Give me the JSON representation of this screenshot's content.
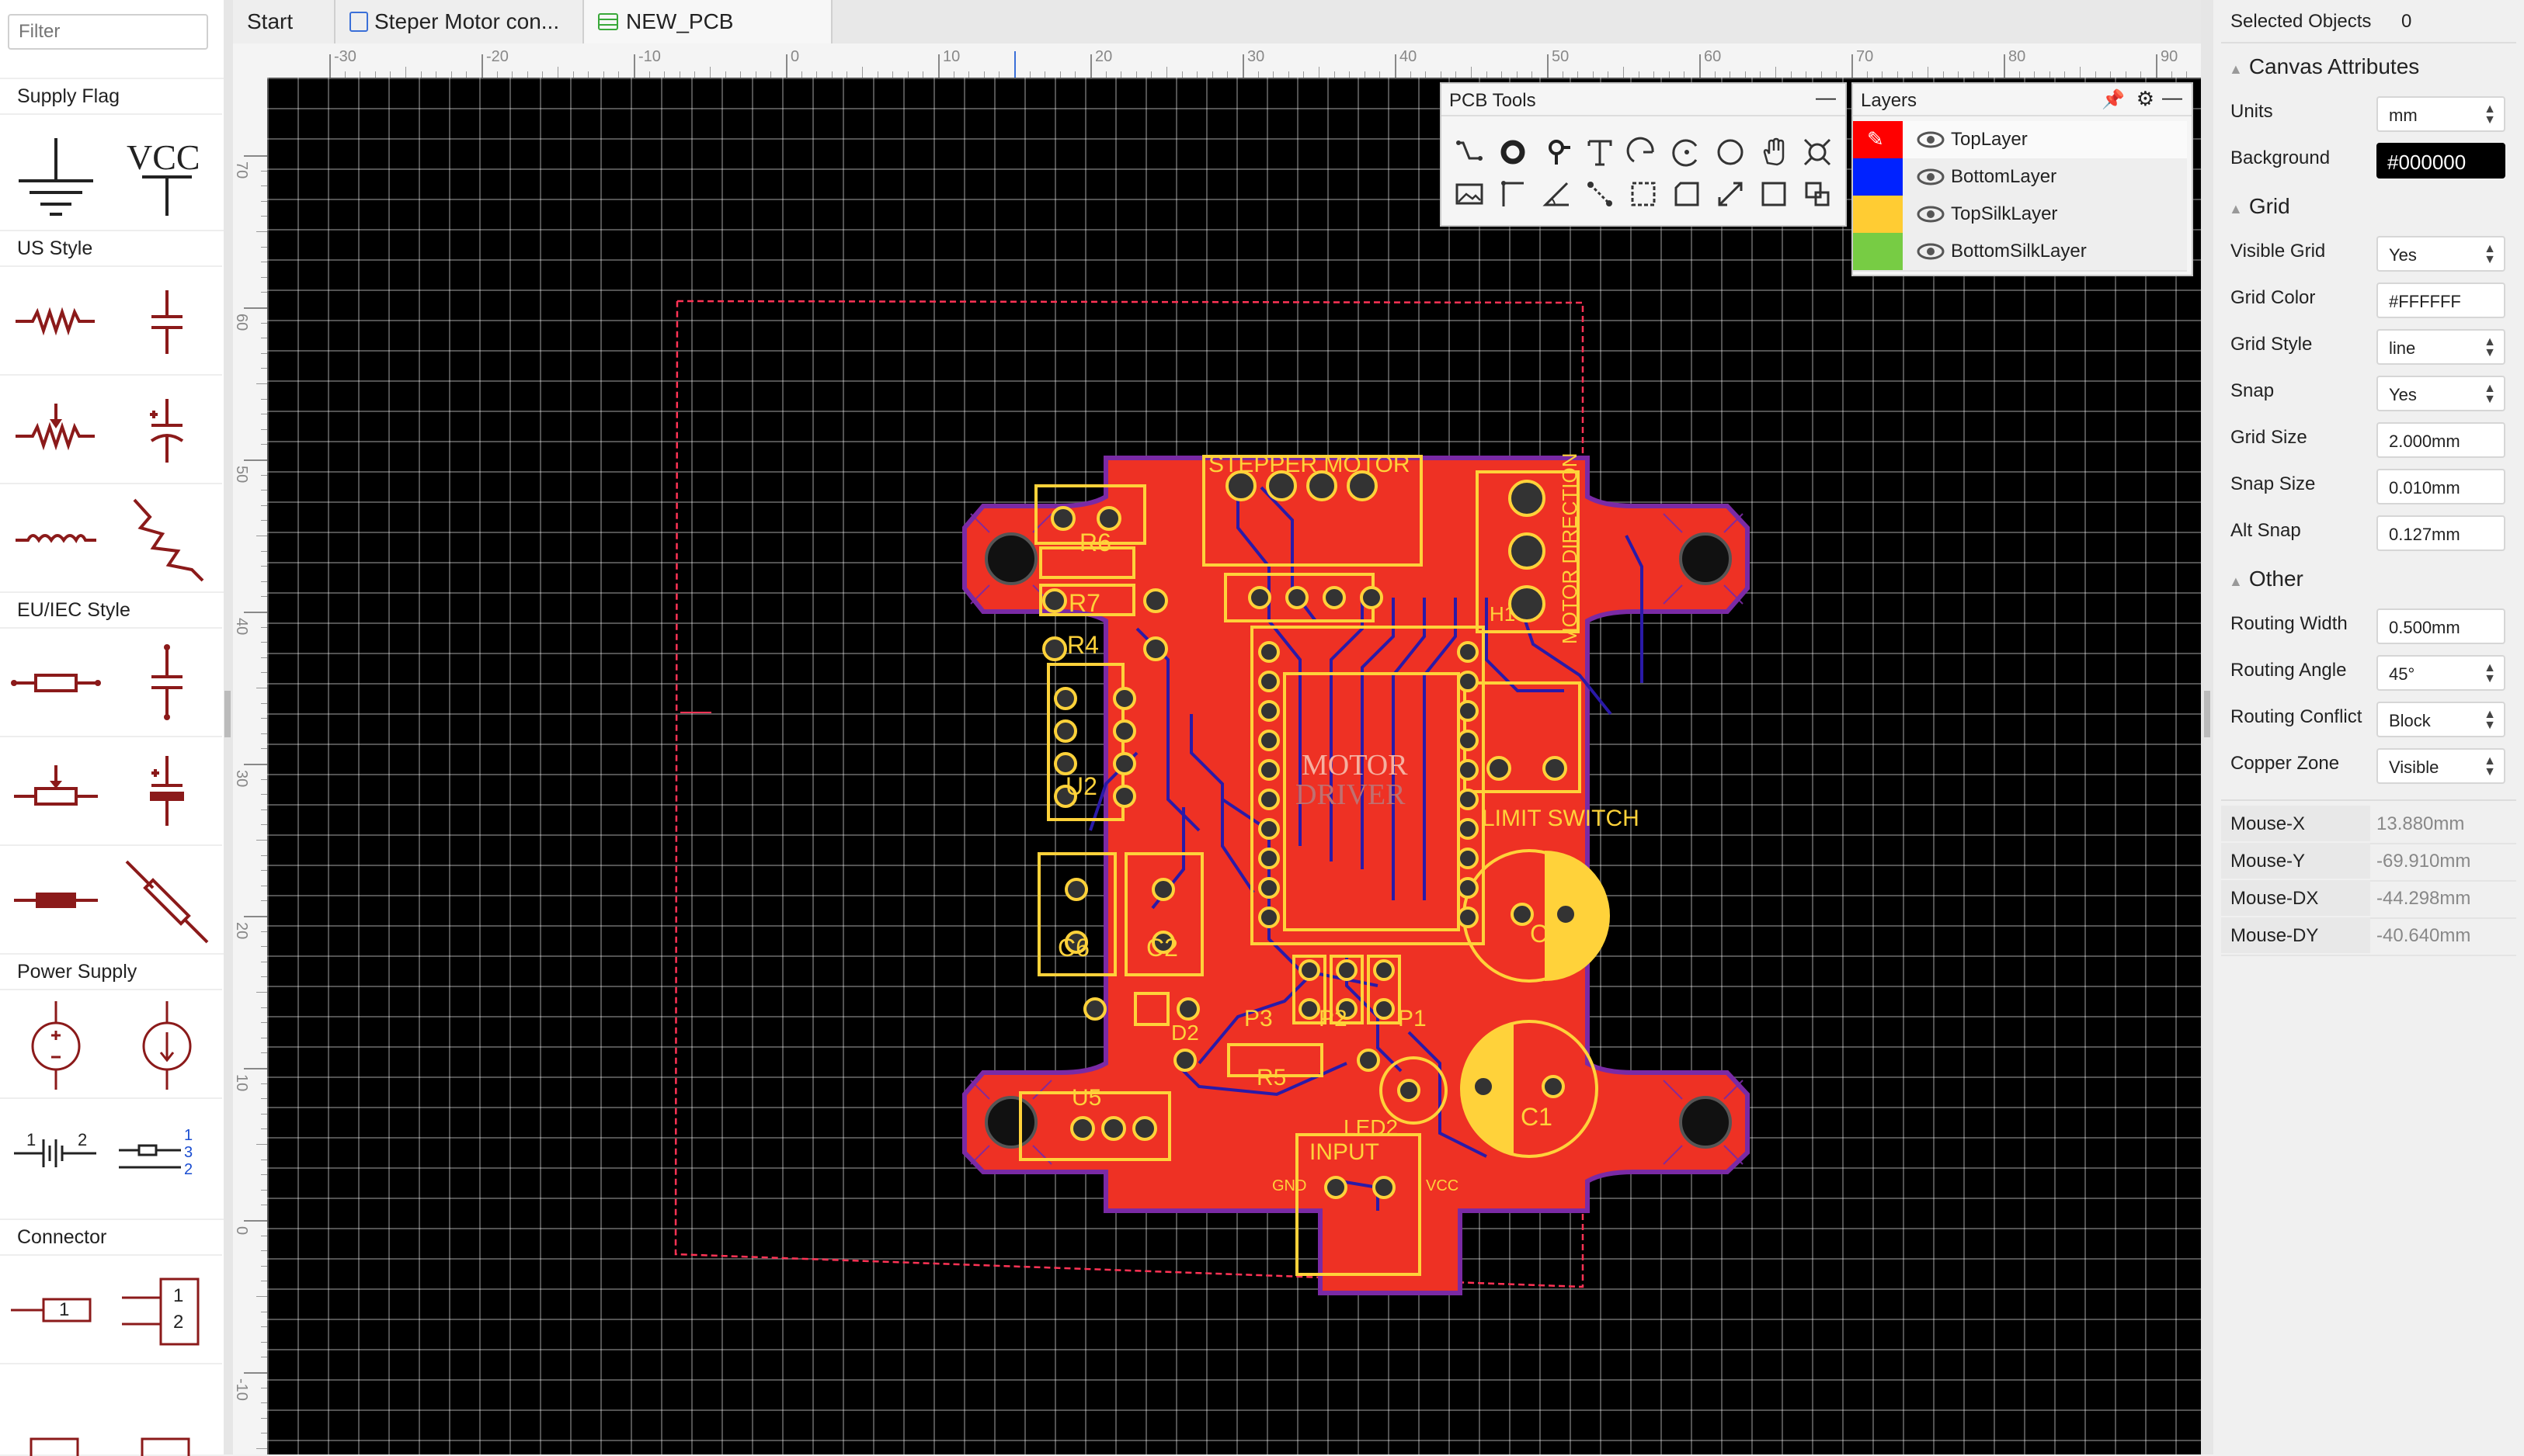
{
  "left_panel": {
    "filter_placeholder": "Filter",
    "categories": {
      "supply_flag": "Supply Flag",
      "us_style": "US Style",
      "eu_style": "EU/IEC Style",
      "power_supply": "Power Supply",
      "connector": "Connector"
    },
    "vcc_symbol": "VCC",
    "connector_pins": [
      "1",
      "1",
      "2"
    ],
    "potentiometer_pins": [
      "1",
      "3",
      "2"
    ],
    "battery_pins": [
      "1",
      "2"
    ]
  },
  "tabs": [
    {
      "label": "Start"
    },
    {
      "label": "Steper Motor con..."
    },
    {
      "label": "NEW_PCB"
    }
  ],
  "ruler": {
    "h_ticks": [
      "-30",
      "-20",
      "-10",
      "0",
      "10",
      "20",
      "30",
      "40",
      "50",
      "60",
      "70",
      "80",
      "90"
    ],
    "v_ticks": [
      "70",
      "60",
      "50",
      "40",
      "30",
      "20",
      "10",
      "0",
      "-10"
    ]
  },
  "pcb_tools": {
    "title": "PCB Tools"
  },
  "layers": {
    "title": "Layers",
    "items": [
      {
        "name": "TopLayer",
        "color": "#ff0000"
      },
      {
        "name": "BottomLayer",
        "color": "#0022ff"
      },
      {
        "name": "TopSilkLayer",
        "color": "#ffcc33"
      },
      {
        "name": "BottomSilkLayer",
        "color": "#77cc44"
      }
    ]
  },
  "board": {
    "labels": [
      "STEPPER MOTOR",
      "MOTOR DIRECTION",
      "LIMIT SWITCH",
      "INPUT",
      "GND",
      "VCC",
      "R6",
      "R7",
      "R4",
      "U2",
      "H1",
      "C6",
      "C2",
      "C5",
      "C1",
      "P3",
      "P2",
      "P1",
      "D2",
      "R5",
      "LED2",
      "U5"
    ],
    "center_text": [
      "MOTOR",
      "DRIVER"
    ]
  },
  "right_panel": {
    "selected_objects": {
      "label": "Selected Objects",
      "value": "0"
    },
    "canvas_attributes": "Canvas Attributes",
    "units": {
      "label": "Units",
      "value": "mm"
    },
    "background": {
      "label": "Background",
      "value": "#000000"
    },
    "grid_section": "Grid",
    "visible_grid": {
      "label": "Visible Grid",
      "value": "Yes"
    },
    "grid_color": {
      "label": "Grid Color",
      "value": "#FFFFFF"
    },
    "grid_style": {
      "label": "Grid Style",
      "value": "line"
    },
    "snap": {
      "label": "Snap",
      "value": "Yes"
    },
    "grid_size": {
      "label": "Grid Size",
      "value": "2.000mm"
    },
    "snap_size": {
      "label": "Snap Size",
      "value": "0.010mm"
    },
    "alt_snap": {
      "label": "Alt Snap",
      "value": "0.127mm"
    },
    "other_section": "Other",
    "routing_width": {
      "label": "Routing Width",
      "value": "0.500mm"
    },
    "routing_angle": {
      "label": "Routing Angle",
      "value": "45°"
    },
    "routing_conflict": {
      "label": "Routing Conflict",
      "value": "Block"
    },
    "copper_zone": {
      "label": "Copper Zone",
      "value": "Visible"
    },
    "mouse": [
      {
        "label": "Mouse-X",
        "value": "13.880mm"
      },
      {
        "label": "Mouse-Y",
        "value": "-69.910mm"
      },
      {
        "label": "Mouse-DX",
        "value": "-44.298mm"
      },
      {
        "label": "Mouse-DY",
        "value": "-40.640mm"
      }
    ]
  }
}
